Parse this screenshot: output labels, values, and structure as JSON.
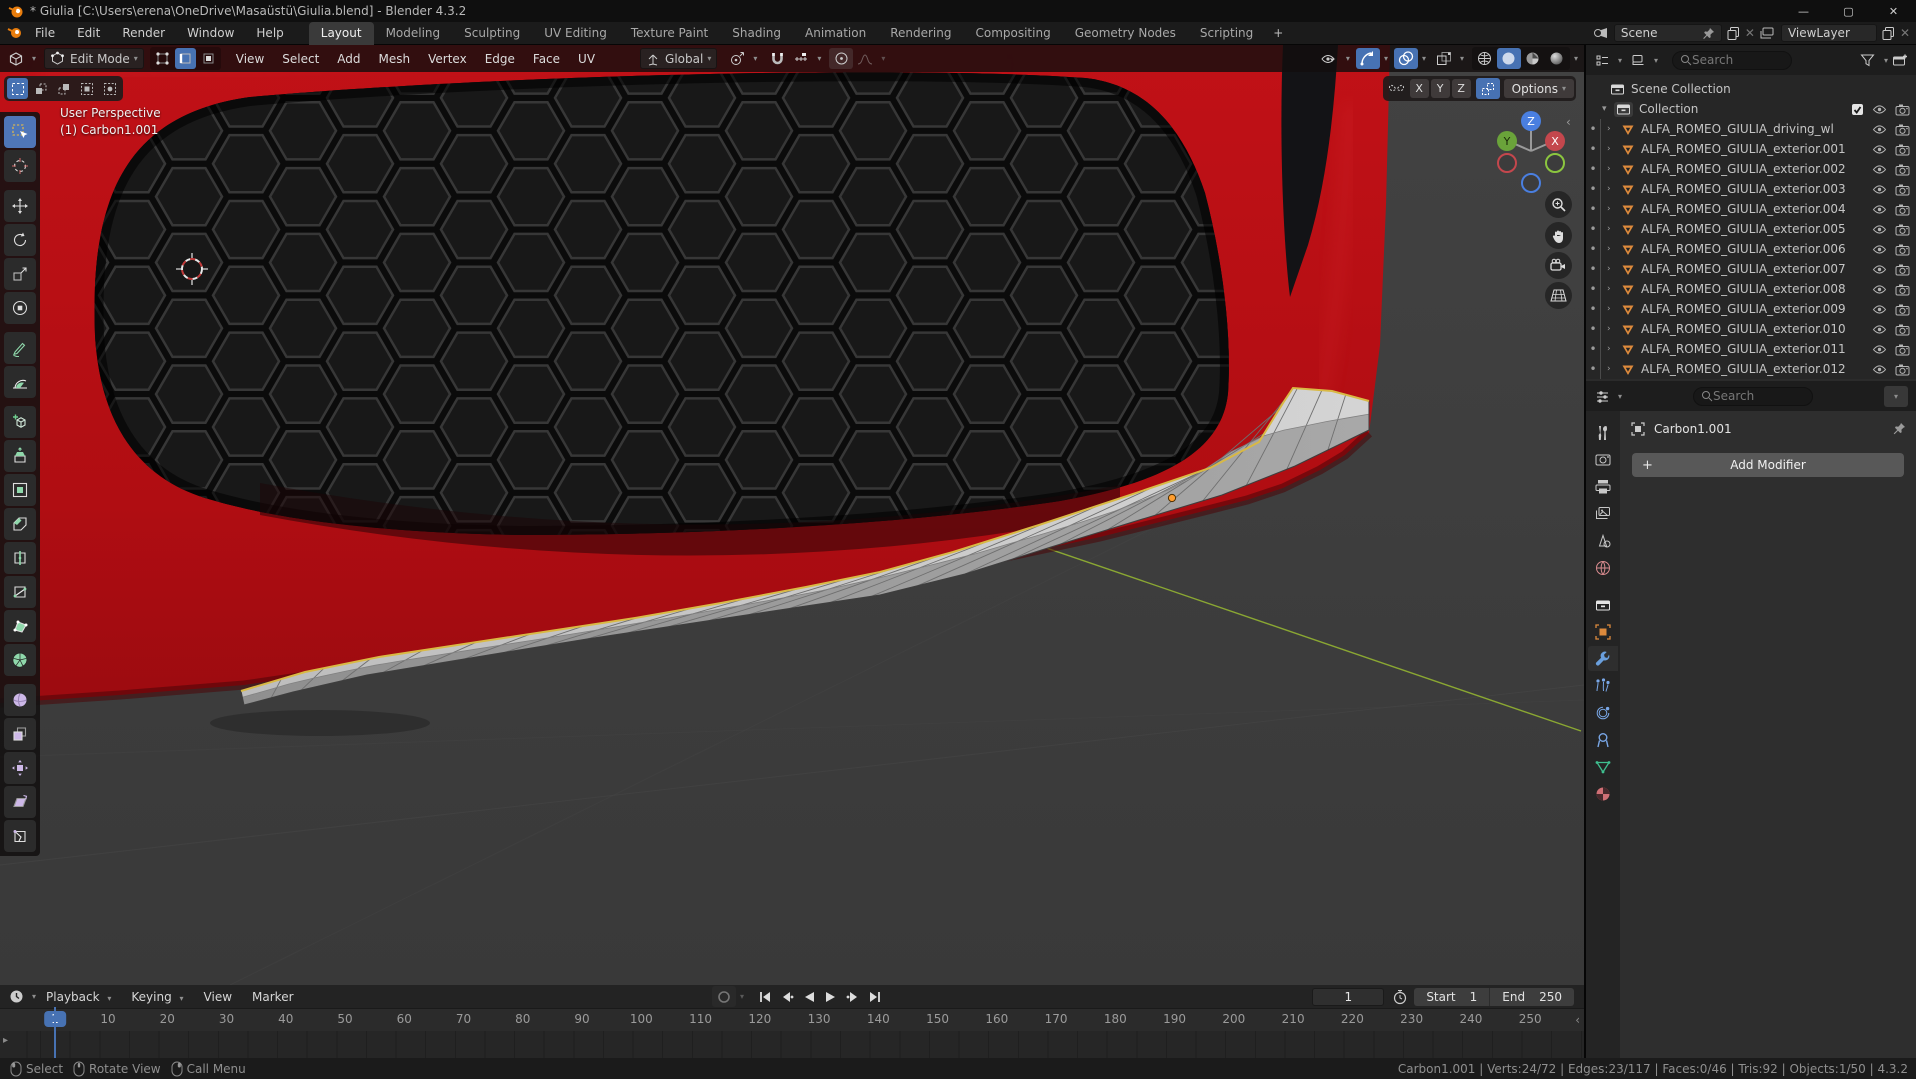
{
  "titlebar": {
    "title": "* Giulia [C:\\Users\\erena\\OneDrive\\Masaüstü\\Giulia.blend] - Blender 4.3.2"
  },
  "topbar": {
    "menus": [
      "File",
      "Edit",
      "Render",
      "Window",
      "Help"
    ],
    "tabs": [
      {
        "label": "Layout",
        "active": true
      },
      {
        "label": "Modeling"
      },
      {
        "label": "Sculpting"
      },
      {
        "label": "UV Editing"
      },
      {
        "label": "Texture Paint"
      },
      {
        "label": "Shading"
      },
      {
        "label": "Animation"
      },
      {
        "label": "Rendering"
      },
      {
        "label": "Compositing"
      },
      {
        "label": "Geometry Nodes"
      },
      {
        "label": "Scripting"
      }
    ],
    "new_tab": "+",
    "scene_value": "Scene",
    "viewlayer_value": "ViewLayer"
  },
  "viewport_header": {
    "mode": "Edit Mode",
    "menus": [
      "View",
      "Select",
      "Add",
      "Mesh",
      "Vertex",
      "Edge",
      "Face",
      "UV"
    ],
    "orientation": "Global",
    "mirror_axes": [
      "X",
      "Y",
      "Z"
    ],
    "options_label": "Options"
  },
  "viewport": {
    "perspective_label": "User Perspective",
    "object_label": "(1) Carbon1.001",
    "gizmo": {
      "x": "X",
      "y": "Y",
      "z": "Z"
    }
  },
  "toolbar": {
    "tools": [
      "select-box",
      "cursor",
      "move",
      "rotate",
      "scale",
      "transform",
      "annotate",
      "measure",
      "add-cube",
      "extrude-region",
      "inset-faces",
      "bevel",
      "loop-cut",
      "knife",
      "poly-build",
      "spin",
      "smooth",
      "edge-slide",
      "shrink-fatten",
      "shear",
      "rip-region"
    ]
  },
  "outliner": {
    "search_placeholder": "Search",
    "scene_collection": "Scene Collection",
    "collection": "Collection",
    "items": [
      "ALFA_ROMEO_GIULIA_driving_wl",
      "ALFA_ROMEO_GIULIA_exterior.001",
      "ALFA_ROMEO_GIULIA_exterior.002",
      "ALFA_ROMEO_GIULIA_exterior.003",
      "ALFA_ROMEO_GIULIA_exterior.004",
      "ALFA_ROMEO_GIULIA_exterior.005",
      "ALFA_ROMEO_GIULIA_exterior.006",
      "ALFA_ROMEO_GIULIA_exterior.007",
      "ALFA_ROMEO_GIULIA_exterior.008",
      "ALFA_ROMEO_GIULIA_exterior.009",
      "ALFA_ROMEO_GIULIA_exterior.010",
      "ALFA_ROMEO_GIULIA_exterior.011",
      "ALFA_ROMEO_GIULIA_exterior.012"
    ]
  },
  "properties": {
    "search_placeholder": "Search",
    "breadcrumb": "Carbon1.001",
    "add_modifier_label": "Add Modifier",
    "tabs": [
      {
        "name": "tool"
      },
      {
        "name": "render"
      },
      {
        "name": "output"
      },
      {
        "name": "view-layer"
      },
      {
        "name": "scene"
      },
      {
        "name": "world"
      },
      {
        "name": "collection",
        "gap": true
      },
      {
        "name": "object"
      },
      {
        "name": "modifiers",
        "active": true
      },
      {
        "name": "particles"
      },
      {
        "name": "physics"
      },
      {
        "name": "constraints"
      },
      {
        "name": "data"
      },
      {
        "name": "material"
      }
    ]
  },
  "timeline": {
    "menus": [
      {
        "label": "Playback",
        "dropdown": true
      },
      {
        "label": "Keying",
        "dropdown": true
      },
      {
        "label": "View"
      },
      {
        "label": "Marker"
      }
    ],
    "frame_field": "1",
    "current_frame_badge": "1",
    "start_label": "Start",
    "start_value": "1",
    "end_label": "End",
    "end_value": "250",
    "ticks": [
      10,
      20,
      30,
      40,
      50,
      60,
      70,
      80,
      90,
      100,
      110,
      120,
      130,
      140,
      150,
      160,
      170,
      180,
      190,
      200,
      210,
      220,
      230,
      240,
      250
    ]
  },
  "statusbar": {
    "hints": [
      {
        "button": "left",
        "label": "Select"
      },
      {
        "button": "middle",
        "label": "Rotate View"
      },
      {
        "button": "right",
        "label": "Call Menu"
      }
    ],
    "stats": "Carbon1.001 | Verts:24/72 | Edges:23/117 | Faces:0/46 | Tris:92 | Objects:1/50 | 4.3.2"
  },
  "colors": {
    "accent": "#4772b3",
    "car_red": "#b40f14",
    "selected_edge": "#d9b944",
    "axis_x": "#c4474d",
    "axis_y": "#6aa33a",
    "axis_z": "#4a7fe0",
    "mesh_icon_orange": "#dd8a3c"
  }
}
